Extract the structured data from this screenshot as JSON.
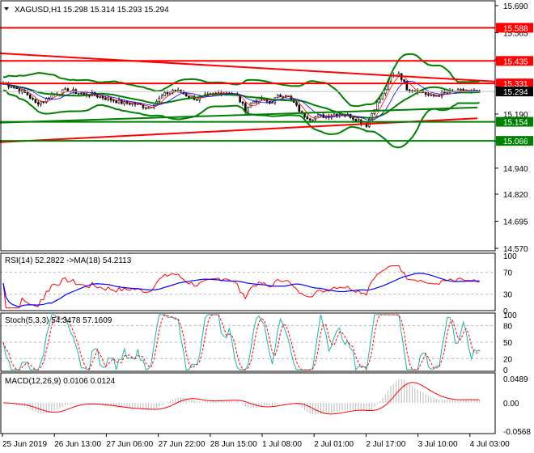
{
  "header": {
    "symbol": "XAGUSD,H1",
    "ohlc": "15.298 15.314 15.293 15.294"
  },
  "price_axis": {
    "ticks": [
      "15.690",
      "15.565",
      "15.440",
      "15.315",
      "15.190",
      "15.065",
      "14.940",
      "14.820",
      "14.695",
      "14.570"
    ],
    "levels": [
      {
        "value": 15.588,
        "label": "15.588",
        "color": "#ff0000"
      },
      {
        "value": 15.435,
        "label": "15.435",
        "color": "#ff0000"
      },
      {
        "value": 15.331,
        "label": "15.331",
        "color": "#ff0000"
      },
      {
        "value": 15.154,
        "label": "15.154",
        "color": "#008000"
      },
      {
        "value": 15.066,
        "label": "15.066",
        "color": "#008000"
      }
    ],
    "current": {
      "value": 15.294,
      "label": "15.294"
    }
  },
  "rsi": {
    "label": "RSI(14) 52.2822  ->MA(18) 54.2113",
    "ticks": [
      "100",
      "70",
      "30",
      "0"
    ]
  },
  "stoch": {
    "label": "Stoch(5,3,3) 54.3478 57.1609",
    "ticks": [
      "100",
      "80",
      "50",
      "20",
      "0"
    ]
  },
  "macd": {
    "label": "MACD(12,26,9) 0.0106 0.0124",
    "ticks": [
      "0.0489",
      "0.00",
      "-0.0568"
    ]
  },
  "time_axis": [
    "25 Jun 2019",
    "26 Jun 13:00",
    "27 Jun 06:00",
    "27 Jun 22:00",
    "28 Jun 15:00",
    "1 Jul 08:00",
    "2 Jul 01:00",
    "2 Jul 17:00",
    "3 Jul 10:00",
    "4 Jul 03:00"
  ],
  "chart_data": {
    "type": "candlestick",
    "symbol": "XAGUSD",
    "timeframe": "H1",
    "ylim": [
      14.57,
      15.69
    ],
    "closes": [
      15.33,
      15.32,
      15.3,
      15.28,
      15.24,
      15.25,
      15.28,
      15.29,
      15.3,
      15.29,
      15.28,
      15.28,
      15.27,
      15.26,
      15.25,
      15.24,
      15.24,
      15.23,
      15.22,
      15.25,
      15.28,
      15.3,
      15.29,
      15.27,
      15.26,
      15.27,
      15.28,
      15.29,
      15.29,
      15.27,
      15.21,
      15.25,
      15.26,
      15.24,
      15.27,
      15.28,
      15.24,
      15.19,
      15.17,
      15.18,
      15.18,
      15.19,
      15.19,
      15.18,
      15.16,
      15.14,
      15.22,
      15.28,
      15.36,
      15.38,
      15.31,
      15.3,
      15.29,
      15.27,
      15.28,
      15.29,
      15.29,
      15.3,
      15.29,
      15.294
    ],
    "trendline_red_desc": [
      15.47,
      15.34
    ],
    "trendline_red_asc": [
      15.06,
      15.17
    ],
    "trendline_green_asc": [
      15.15,
      15.22
    ]
  },
  "colors": {
    "up": "#000000",
    "red": "#ff0000",
    "green": "#008000",
    "blue": "#0000ff",
    "teal": "#20b2aa"
  }
}
